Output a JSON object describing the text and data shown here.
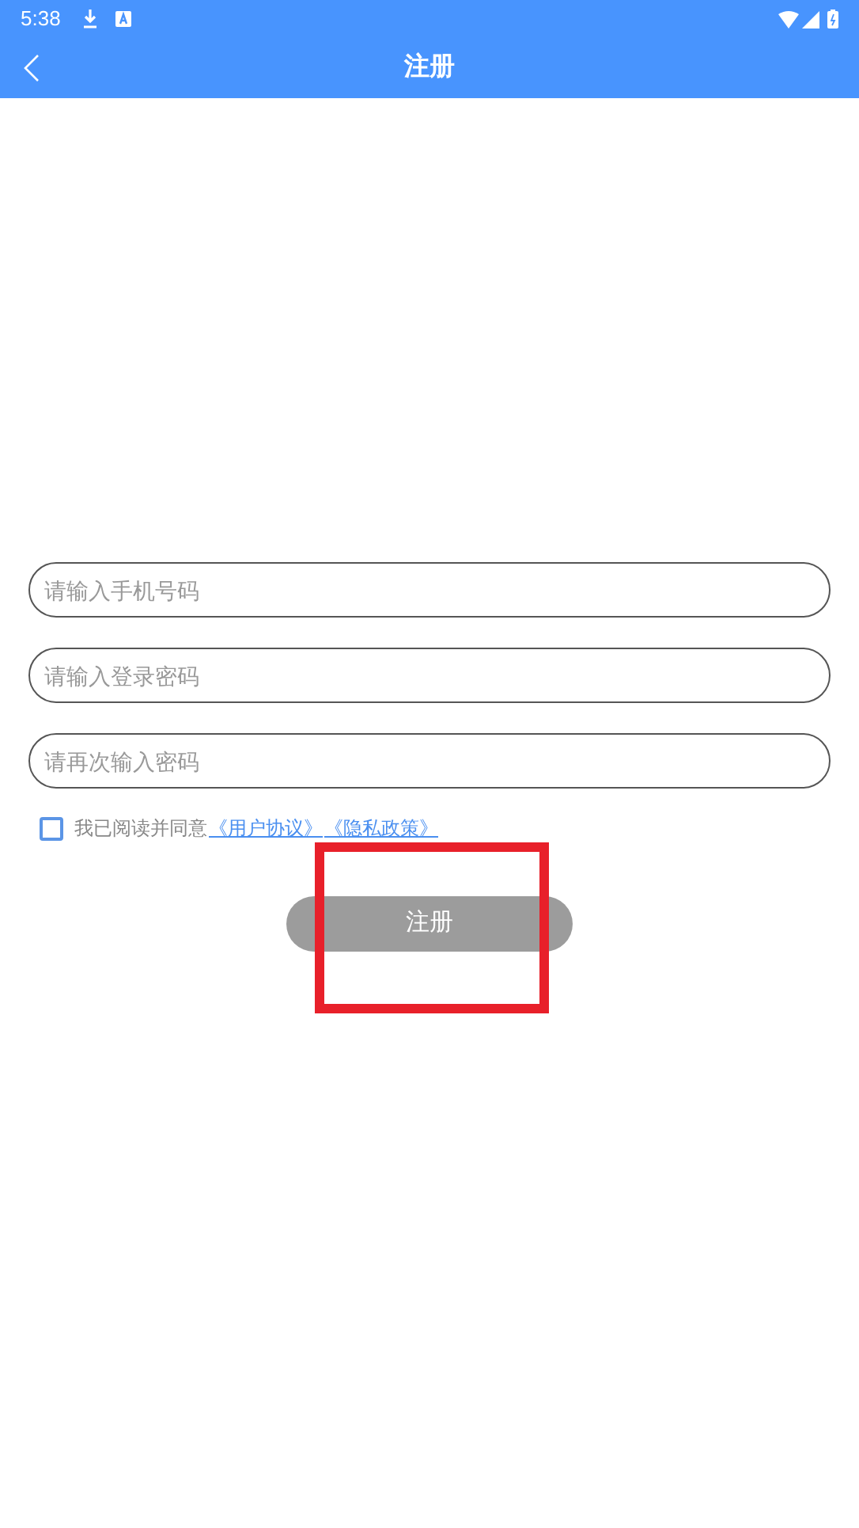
{
  "status_bar": {
    "time": "5:38"
  },
  "header": {
    "title": "注册"
  },
  "fields": [
    {
      "placeholder": "请输入手机号码"
    },
    {
      "placeholder": "请输入登录密码"
    },
    {
      "placeholder": "请再次输入密码"
    }
  ],
  "agreement": {
    "checked": false,
    "text": "我已阅读并同意",
    "links": [
      "《用户协议》",
      "《隐私政策》"
    ]
  },
  "submit": {
    "label": "注册",
    "disabled": true
  }
}
